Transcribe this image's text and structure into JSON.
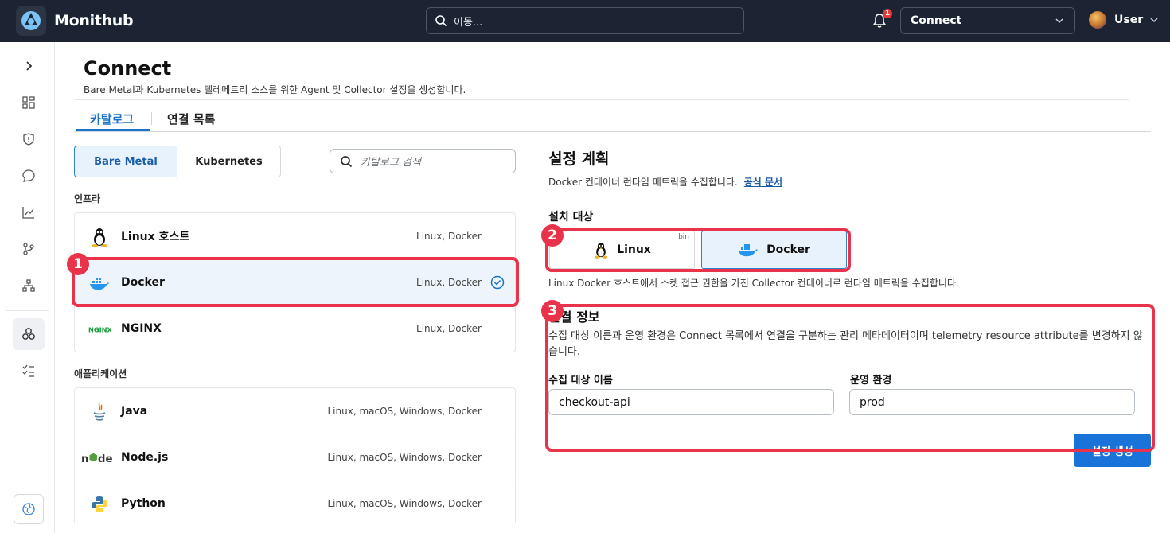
{
  "header": {
    "brand": "Monithub",
    "search_text": "이동...",
    "notification_count": "1",
    "workspace": "Connect",
    "user": "User"
  },
  "rail": {
    "items": [
      "expand-icon",
      "dashboard-icon",
      "shield-icon",
      "chat-icon",
      "chart-icon",
      "branch-icon",
      "hierarchy-icon",
      "connect-icon",
      "checklist-icon",
      "globe-icon"
    ],
    "active": "connect-icon"
  },
  "page": {
    "title": "Connect",
    "subtitle": "Bare Metal과 Kubernetes 텔레메트리 소스를 위한 Agent 및 Collector 설정을 생성합니다.",
    "tabs": [
      {
        "label": "카탈로그",
        "active": true
      },
      {
        "label": "연결 목록",
        "active": false
      }
    ]
  },
  "catalog": {
    "segments": [
      {
        "label": "Bare Metal",
        "active": true
      },
      {
        "label": "Kubernetes",
        "active": false
      }
    ],
    "search_placeholder": "카탈로그 검색",
    "infra_label": "인프라",
    "infra": [
      {
        "name": "Linux 호스트",
        "platforms": "Linux, Docker",
        "icon": "linux-icon"
      },
      {
        "name": "Docker",
        "platforms": "Linux, Docker",
        "icon": "docker-icon",
        "selected": true
      },
      {
        "name": "NGINX",
        "platforms": "Linux, Docker",
        "icon": "nginx-icon"
      }
    ],
    "apps_label": "애플리케이션",
    "apps": [
      {
        "name": "Java",
        "platforms": "Linux, macOS, Windows, Docker",
        "icon": "java-icon"
      },
      {
        "name": "Node.js",
        "platforms": "Linux, macOS, Windows, Docker",
        "icon": "nodejs-icon"
      },
      {
        "name": "Python",
        "platforms": "Linux, macOS, Windows, Docker",
        "icon": "python-icon"
      }
    ]
  },
  "plan": {
    "title": "설정 계획",
    "description": "Docker 컨테이너 런타임 메트릭을 수집합니다.",
    "docs_link": "공식 문서",
    "target_label": "설치 대상",
    "targets": [
      {
        "label": "Linux",
        "tag": "bin",
        "selected": false
      },
      {
        "label": "Docker",
        "selected": true
      }
    ],
    "target_note": "Linux Docker 호스트에서 소켓 접근 권한을 가진 Collector 컨테이너로 런타임 메트릭을 수집합니다.",
    "info_title": "연결 정보",
    "info_desc": "수집 대상 이름과 운영 환경은 Connect 목록에서 연결을 구분하는 관리 메타데이터이며 telemetry resource attribute를 변경하지 않습니다.",
    "fields": [
      {
        "label": "수집 대상 이름",
        "value": "checkout-api"
      },
      {
        "label": "운영 환경",
        "value": "prod"
      }
    ],
    "generate_button": "설정 생성"
  },
  "annotations": [
    "1",
    "2",
    "3"
  ],
  "colors": {
    "topbar": "#1c2434",
    "accent": "#1a73c9",
    "highlight": "#e8334a",
    "selected_bg": "#eef4fb"
  }
}
